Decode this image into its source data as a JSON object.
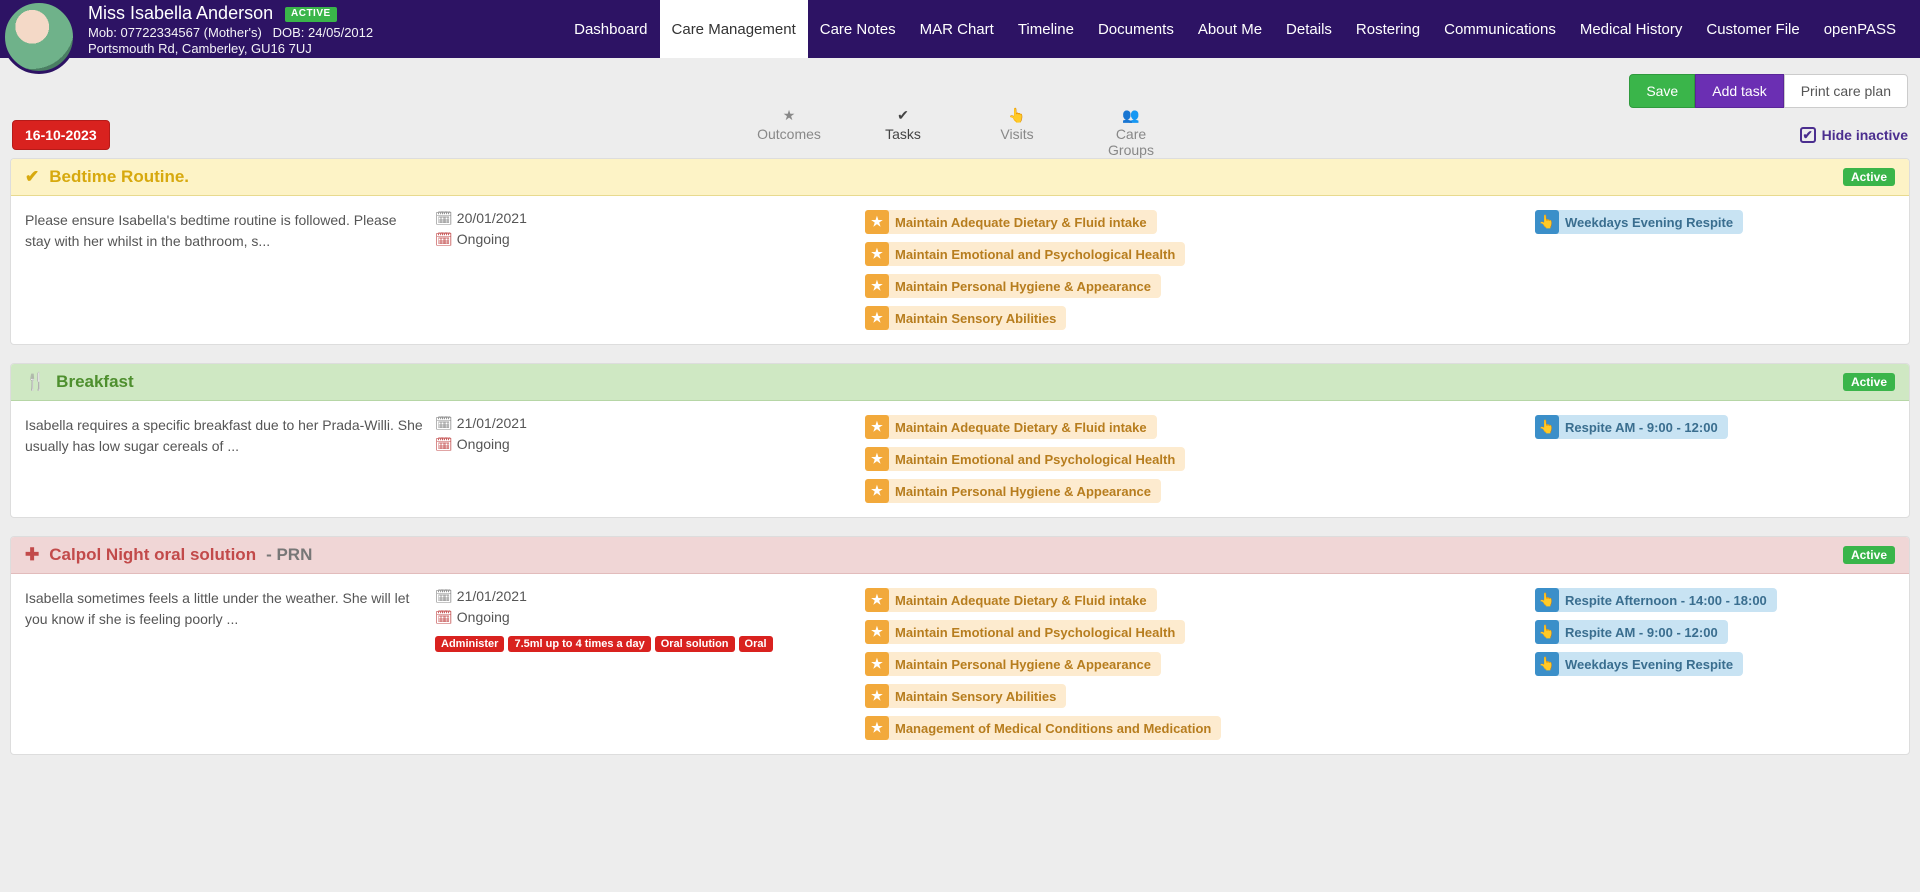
{
  "patient": {
    "name": "Miss Isabella Anderson",
    "status": "ACTIVE",
    "mob_label": "Mob:",
    "mob": "07722334567 (Mother's)",
    "dob_label": "DOB:",
    "dob": "24/05/2012",
    "address": "Portsmouth Rd, Camberley, GU16 7UJ"
  },
  "nav": [
    "Dashboard",
    "Care Management",
    "Care Notes",
    "MAR Chart",
    "Timeline",
    "Documents",
    "About Me",
    "Details",
    "Rostering",
    "Communications",
    "Medical History",
    "Customer File",
    "openPASS"
  ],
  "nav_active": 1,
  "actions": {
    "save": "Save",
    "add": "Add task",
    "print": "Print care plan"
  },
  "date": "16-10-2023",
  "subtabs": [
    "Outcomes",
    "Tasks",
    "Visits",
    "Care Groups"
  ],
  "subtabs_active": 1,
  "hide_inactive_label": "Hide inactive",
  "tasks": [
    {
      "hdrClass": "hdr-yellow",
      "icon": "ico-check",
      "title": "Bedtime Routine.",
      "suffix": "",
      "status": "Active",
      "desc": "Please ensure Isabella's bedtime routine is followed. Please stay with her whilst in the bathroom, s...",
      "startDate": "20/01/2021",
      "ongoing": "Ongoing",
      "redTags": [],
      "outcomes": [
        "Maintain Adequate Dietary & Fluid intake",
        "Maintain Emotional and Psychological Health",
        "Maintain Personal Hygiene & Appearance",
        "Maintain Sensory Abilities"
      ],
      "visits": [
        "Weekdays Evening Respite"
      ]
    },
    {
      "hdrClass": "hdr-green",
      "icon": "ico-fork",
      "title": "Breakfast",
      "suffix": "",
      "status": "Active",
      "desc": "Isabella requires a specific breakfast due to her Prada-Willi. She usually has low sugar cereals of ...",
      "startDate": "21/01/2021",
      "ongoing": "Ongoing",
      "redTags": [],
      "outcomes": [
        "Maintain Adequate Dietary & Fluid intake",
        "Maintain Emotional and Psychological Health",
        "Maintain Personal Hygiene & Appearance"
      ],
      "visits": [
        "Respite AM - 9:00 - 12:00"
      ]
    },
    {
      "hdrClass": "hdr-pink",
      "icon": "ico-plus",
      "title": "Calpol Night oral solution",
      "suffix": " - PRN",
      "status": "Active",
      "desc": "Isabella sometimes feels a little under the weather. She will let you know if she is feeling poorly ...",
      "startDate": "21/01/2021",
      "ongoing": "Ongoing",
      "redTags": [
        "Administer",
        "7.5ml up to 4 times a day",
        "Oral solution",
        "Oral"
      ],
      "outcomes": [
        "Maintain Adequate Dietary & Fluid intake",
        "Maintain Emotional and Psychological Health",
        "Maintain Personal Hygiene & Appearance",
        "Maintain Sensory Abilities",
        "Management of Medical Conditions and Medication"
      ],
      "visits": [
        "Respite Afternoon - 14:00 - 18:00",
        "Respite AM - 9:00 - 12:00",
        "Weekdays Evening Respite"
      ]
    }
  ]
}
